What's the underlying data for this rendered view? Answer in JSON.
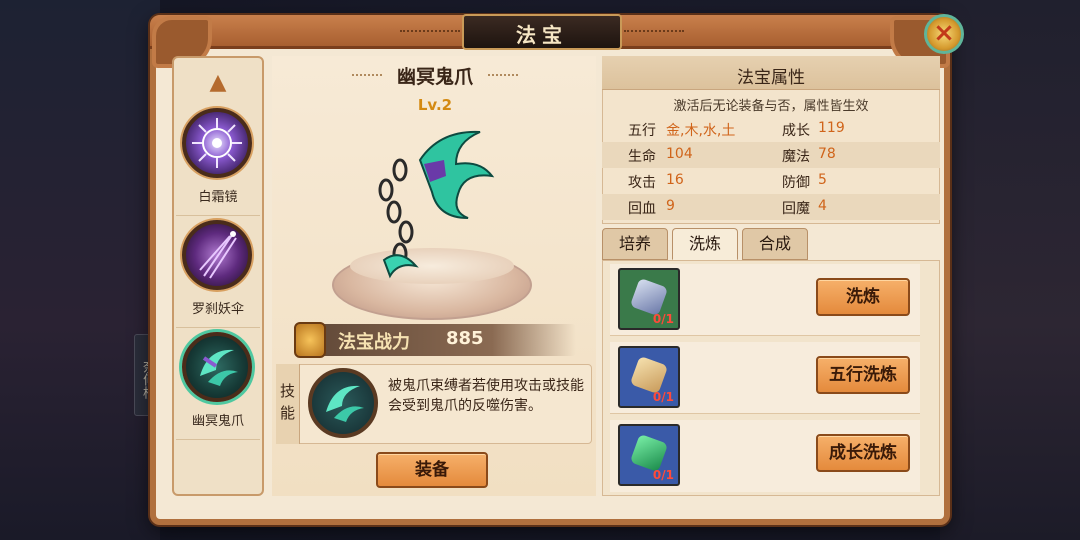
{
  "window": {
    "title": "法宝",
    "close_label": "×"
  },
  "side_tag": "奈何桥",
  "sidebar": {
    "items": [
      {
        "label": "白霜镜"
      },
      {
        "label": "罗刹妖伞"
      },
      {
        "label": "幽冥鬼爪"
      }
    ],
    "selected": "幽冥鬼爪"
  },
  "item": {
    "name": "幽冥鬼爪",
    "level": "Lv.2",
    "power_label": "法宝战力",
    "power_value": "885",
    "skill_tag": "技能",
    "skill_desc": "被鬼爪束缚者若使用攻击或技能会受到鬼爪的反噬伤害。",
    "equip_label": "装备"
  },
  "attributes": {
    "title": "法宝属性",
    "note": "激活后无论装备与否，属性皆生效",
    "rows": [
      {
        "k1": "五行",
        "v1": "金,木,水,土",
        "k2": "成长",
        "v2": "119"
      },
      {
        "k1": "生命",
        "v1": "104",
        "k2": "魔法",
        "v2": "78"
      },
      {
        "k1": "攻击",
        "v1": "16",
        "k2": "防御",
        "v2": "5"
      },
      {
        "k1": "回血",
        "v1": "9",
        "k2": "回魔",
        "v2": "4"
      }
    ]
  },
  "tabs": [
    {
      "label": "培养"
    },
    {
      "label": "洗炼"
    },
    {
      "label": "合成"
    }
  ],
  "active_tab": "洗炼",
  "refine": [
    {
      "count": "0/1",
      "button": "洗炼",
      "stone": "blue-crystal-stone"
    },
    {
      "count": "0/1",
      "button": "五行洗炼",
      "stone": "five-elements-stone"
    },
    {
      "count": "0/1",
      "button": "成长洗炼",
      "stone": "green-gem-stone"
    }
  ],
  "colors": {
    "frame": "#b0703e",
    "accent": "#e48a3c",
    "value": "#d0641a",
    "level": "#d48a12"
  }
}
